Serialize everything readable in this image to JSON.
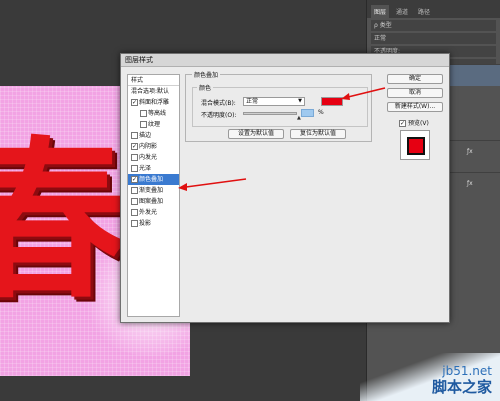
{
  "canvas": {
    "text": "春",
    "text_color": "#e5151b",
    "background_color": "#f2a3e4"
  },
  "right_panel": {
    "tabs": [
      "图层",
      "通道",
      "路径"
    ],
    "kind_filter": "ρ 类型",
    "blend_mode": "正常",
    "opacity_label": "不透明度:",
    "fill_label": "填充:",
    "layer_suffix_1": "ƒx",
    "layer_suffix_2": "ƒx"
  },
  "dialog": {
    "title": "图层样式",
    "styles_header": "样式",
    "styles": [
      {
        "label": "混合选项:默认",
        "checked": null
      },
      {
        "label": "斜面和浮雕",
        "checked": true
      },
      {
        "label": "等高线",
        "checked": false,
        "sub": true
      },
      {
        "label": "纹理",
        "checked": false,
        "sub": true
      },
      {
        "label": "描边",
        "checked": false
      },
      {
        "label": "内阴影",
        "checked": true
      },
      {
        "label": "内发光",
        "checked": false
      },
      {
        "label": "光泽",
        "checked": false
      },
      {
        "label": "颜色叠加",
        "checked": true,
        "selected": true
      },
      {
        "label": "渐变叠加",
        "checked": false
      },
      {
        "label": "图案叠加",
        "checked": false
      },
      {
        "label": "外发光",
        "checked": false
      },
      {
        "label": "投影",
        "checked": false
      }
    ],
    "section_title": "颜色叠加",
    "color_group_title": "颜色",
    "blend_mode_label": "混合模式(B):",
    "blend_mode_value": "正常",
    "overlay_color": "#e60012",
    "opacity_label": "不透明度(O):",
    "opacity_value": "",
    "opacity_unit": "%",
    "set_default_button": "设置为默认值",
    "reset_default_button": "复位为默认值",
    "ok_button": "确定",
    "cancel_button": "取消",
    "new_style_button": "新建样式(W)...",
    "preview_label": "预览(V)",
    "preview_checked": true
  },
  "watermark": {
    "line1": "jb51.net",
    "line2": "脚本之家"
  }
}
